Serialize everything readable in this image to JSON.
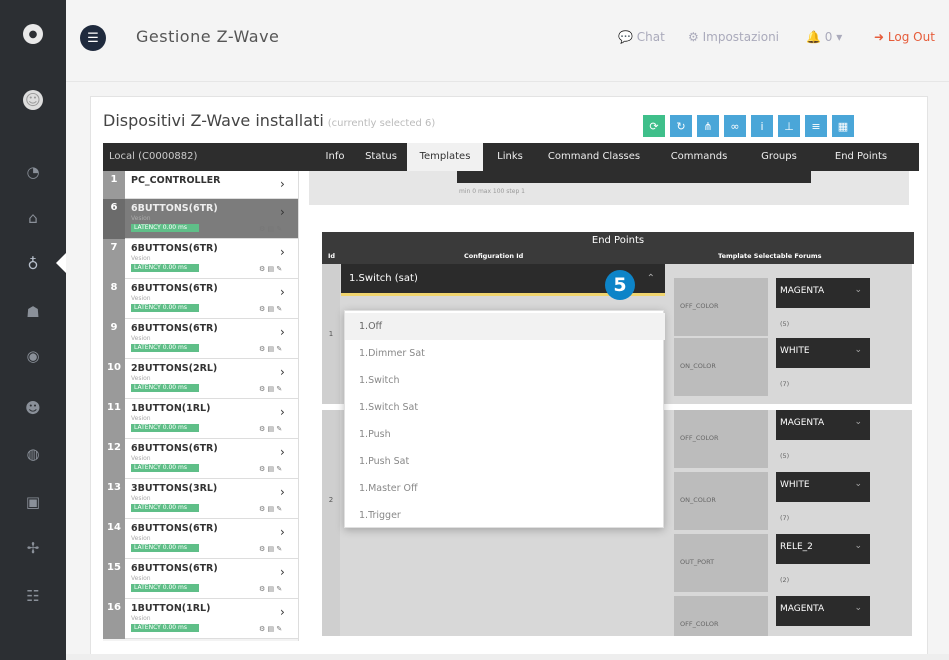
{
  "sidebar": {
    "icons": [
      "logo-icon",
      "user-avatar-icon",
      "dashboard-icon",
      "home-icon",
      "zwave-icon",
      "network-icon",
      "camera-icon",
      "users-icon",
      "globe-icon",
      "device-icon",
      "topology-icon",
      "groups-icon"
    ]
  },
  "header": {
    "title": "Gestione Z-Wave",
    "chat": "Chat",
    "settings": "Impostazioni",
    "notifications": "0",
    "logout": "Log Out"
  },
  "panel": {
    "title": "Dispositivi Z-Wave installati",
    "subtitle": "(currently selected 6)",
    "toolbar": [
      "refresh-icon",
      "sync-icon",
      "tree-icon",
      "link-icon",
      "info-icon",
      "network-icon",
      "list-icon",
      "grid-icon"
    ]
  },
  "tabs": {
    "local": "Local (C0000882)",
    "items": [
      "Info",
      "Status",
      "Templates",
      "Links",
      "Command Classes",
      "Commands",
      "Groups",
      "End Points"
    ],
    "active": "Templates"
  },
  "devices": [
    {
      "num": "1",
      "name": "PC_CONTROLLER",
      "sub": "",
      "badge": ""
    },
    {
      "num": "6",
      "name": "6BUTTONS(6TR)",
      "sub": "Vesion",
      "badge": "LATENCY 0.00 ms"
    },
    {
      "num": "7",
      "name": "6BUTTONS(6TR)",
      "sub": "Vesion",
      "badge": "LATENCY 0.00 ms"
    },
    {
      "num": "8",
      "name": "6BUTTONS(6TR)",
      "sub": "Vesion",
      "badge": "LATENCY 0.00 ms"
    },
    {
      "num": "9",
      "name": "6BUTTONS(6TR)",
      "sub": "Vesion",
      "badge": "LATENCY 0.00 ms"
    },
    {
      "num": "10",
      "name": "2BUTTONS(2RL)",
      "sub": "Vesion",
      "badge": "LATENCY 0.00 ms"
    },
    {
      "num": "11",
      "name": "1BUTTON(1RL)",
      "sub": "Vesion",
      "badge": "LATENCY 0.00 ms"
    },
    {
      "num": "12",
      "name": "6BUTTONS(6TR)",
      "sub": "Vesion",
      "badge": "LATENCY 0.00 ms"
    },
    {
      "num": "13",
      "name": "3BUTTONS(3RL)",
      "sub": "Vesion",
      "badge": "LATENCY 0.00 ms"
    },
    {
      "num": "14",
      "name": "6BUTTONS(6TR)",
      "sub": "Vesion",
      "badge": "LATENCY 0.00 ms"
    },
    {
      "num": "15",
      "name": "6BUTTONS(6TR)",
      "sub": "Vesion",
      "badge": "LATENCY 0.00 ms"
    },
    {
      "num": "16",
      "name": "1BUTTON(1RL)",
      "sub": "Vesion",
      "badge": "LATENCY 0.00 ms"
    }
  ],
  "config": {
    "hint": "min 0 max 100 step 1"
  },
  "endpoints": {
    "title": "End Points",
    "col_id": "Id",
    "col_config": "Configuration Id",
    "col_forums": "Template Selectable Forums",
    "row1_id": "1",
    "row2_id": "2",
    "combo_value": "1.Switch (sat)",
    "options": [
      "1.Off",
      "1.Dimmer Sat",
      "1.Switch",
      "1.Switch Sat",
      "1.Push",
      "1.Push Sat",
      "1.Master Off",
      "1.Trigger"
    ],
    "fields": [
      {
        "name": "OFF_COLOR",
        "value": "MAGENTA",
        "sub": "(5)"
      },
      {
        "name": "ON_COLOR",
        "value": "WHITE",
        "sub": "(7)"
      },
      {
        "name": "OFF_COLOR",
        "value": "MAGENTA",
        "sub": "(5)"
      },
      {
        "name": "ON_COLOR",
        "value": "WHITE",
        "sub": "(7)"
      },
      {
        "name": "OUT_PORT",
        "value": "RELE_2",
        "sub": "(2)"
      },
      {
        "name": "OFF_COLOR",
        "value": "MAGENTA",
        "sub": ""
      }
    ]
  },
  "step_badge": "5"
}
